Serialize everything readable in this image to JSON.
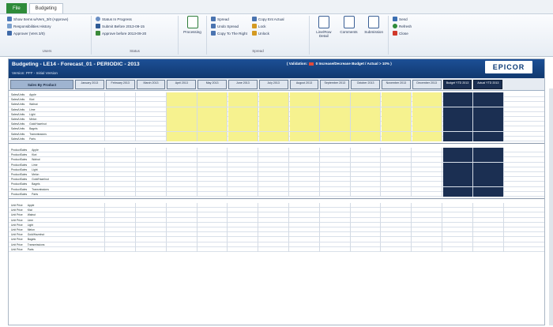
{
  "tabs": [
    "File",
    "Budgeting"
  ],
  "ribbon": {
    "users": {
      "items": [
        "Show Items w/Vers_3/0 (Approve)",
        "Responsibilities History",
        "Approver (Vers 3/0)"
      ],
      "label": "Users"
    },
    "status": {
      "items": [
        "Status In Progress",
        "Submit Before 2013-09-15",
        "Approve before 2013-09-20"
      ],
      "label": "Status"
    },
    "processing": "Processing",
    "spread": {
      "col1": [
        "Spread",
        "Undo Spread",
        "Copy To The Right"
      ],
      "col2": [
        "Copy Ent Actual",
        "Lock",
        "Unlock"
      ],
      "label": "Spread"
    },
    "buttons": [
      "Line/Row Detail",
      "Comments",
      "Submission"
    ],
    "right": [
      "Send",
      "Refresh",
      "Close"
    ]
  },
  "panel": {
    "title": "Budgeting - LE14 - Forecast_01 - PERIODIC - 2013",
    "subtitle": "Version: PFF - Initial Version",
    "legend_left": "( Validation:",
    "legend_right": "0 Increase/Decrease Budget / Actual > 10% )",
    "logo": "EPICOR"
  },
  "columns": [
    "Sales By Product",
    "January 2013",
    "February 2013",
    "March 2013",
    "April 2013",
    "May 2013",
    "June 2013",
    "July 2013",
    "August 2013",
    "September 2013",
    "October 2013",
    "November 2013",
    "December 2013",
    "Budget YTD 2013",
    "Actual YTD 2013"
  ],
  "sections": [
    {
      "prefix": "Sales/Units",
      "products": [
        "Apple",
        "Kiwi",
        "Walnut",
        "Lime",
        "Light",
        "Melon",
        "Gold/Hazelnut",
        "Bagels",
        "Transmissions",
        "Parts"
      ]
    },
    {
      "prefix": "ProductSales",
      "products": [
        "Apple",
        "Kiwi",
        "Walnut",
        "Lime",
        "Light",
        "Melon",
        "Gold/Hazelnut",
        "Bagels",
        "Transmissions",
        "Parts"
      ]
    },
    {
      "prefix": "Unit Price",
      "products": [
        "Apple",
        "Kiwi",
        "Walnut",
        "Lime",
        "Light",
        "Melon",
        "Gold/Hazelnut",
        "Bagels",
        "Transmissions",
        "Parts"
      ]
    }
  ],
  "colors": {
    "header_blue": "#1c4f96",
    "yellow_cells": "#f6f28f",
    "dark_cells": "#1b2f52",
    "validation_red": "#e34a3a",
    "file_tab": "#2e8b3a"
  }
}
